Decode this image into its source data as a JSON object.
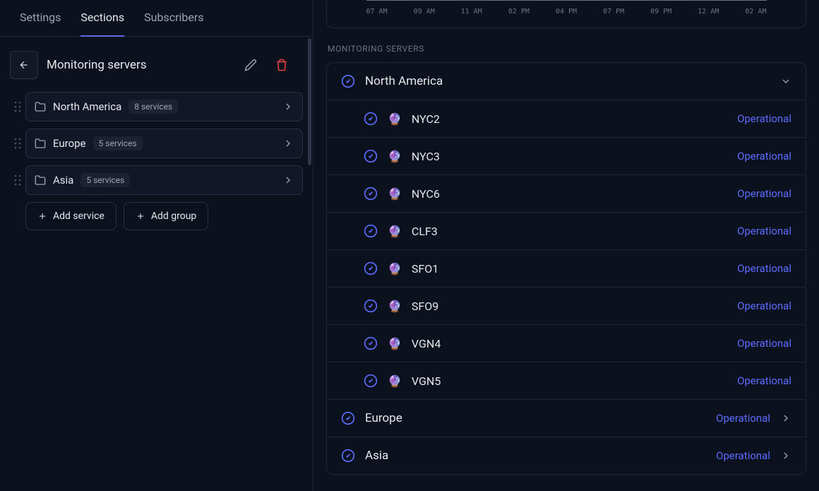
{
  "tabs": {
    "settings": "Settings",
    "sections": "Sections",
    "subscribers": "Subscribers"
  },
  "header": {
    "title": "Monitoring servers"
  },
  "groups": [
    {
      "name": "North America",
      "count": "8 services"
    },
    {
      "name": "Europe",
      "count": "5 services"
    },
    {
      "name": "Asia",
      "count": "5 services"
    }
  ],
  "buttons": {
    "add_service": "Add service",
    "add_group": "Add group"
  },
  "timeline": [
    "07 AM",
    "09 AM",
    "11 AM",
    "02 PM",
    "04 PM",
    "07 PM",
    "09 PM",
    "12 AM",
    "02 AM"
  ],
  "main": {
    "section_label": "MONITORING SERVERS",
    "status_ok": "Operational",
    "regions": [
      {
        "name": "North America",
        "expanded": true,
        "services": [
          {
            "emoji": "🔮",
            "name": "NYC2",
            "status": "Operational"
          },
          {
            "emoji": "🔮",
            "name": "NYC3",
            "status": "Operational"
          },
          {
            "emoji": "🔮",
            "name": "NYC6",
            "status": "Operational"
          },
          {
            "emoji": "🔮",
            "name": "CLF3",
            "status": "Operational"
          },
          {
            "emoji": "🔮",
            "name": "SFO1",
            "status": "Operational"
          },
          {
            "emoji": "🔮",
            "name": "SFO9",
            "status": "Operational"
          },
          {
            "emoji": "🔮",
            "name": "VGN4",
            "status": "Operational"
          },
          {
            "emoji": "🔮",
            "name": "VGN5",
            "status": "Operational"
          }
        ]
      },
      {
        "name": "Europe",
        "expanded": false,
        "status": "Operational"
      },
      {
        "name": "Asia",
        "expanded": false,
        "status": "Operational"
      }
    ]
  }
}
